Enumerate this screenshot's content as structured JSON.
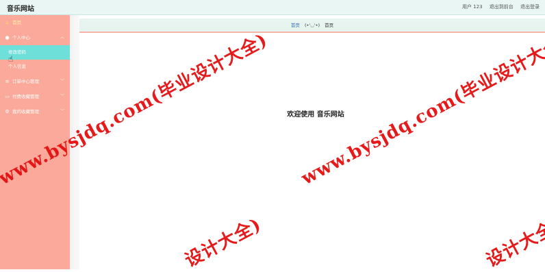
{
  "header": {
    "app_title": "音乐网站",
    "user_label": "用户 123",
    "front_link": "退出到前台",
    "logout_link": "退出登录"
  },
  "sidebar": {
    "home": "首页",
    "personal_center": "个人中心",
    "change_password": "修改密码",
    "personal_info": "个人信息",
    "order_mgmt": "订单中心管理",
    "collection_mgmt": "付费收藏管理",
    "my_collection": "我的收藏管理"
  },
  "breadcrumb": {
    "home": "首页",
    "face": "(•'◡'•)",
    "current": "首页"
  },
  "main": {
    "welcome": "欢迎使用 音乐网站"
  },
  "watermark": {
    "text": "www.bysjdq.com(毕业设计大全)",
    "partial": "设计大全)"
  }
}
